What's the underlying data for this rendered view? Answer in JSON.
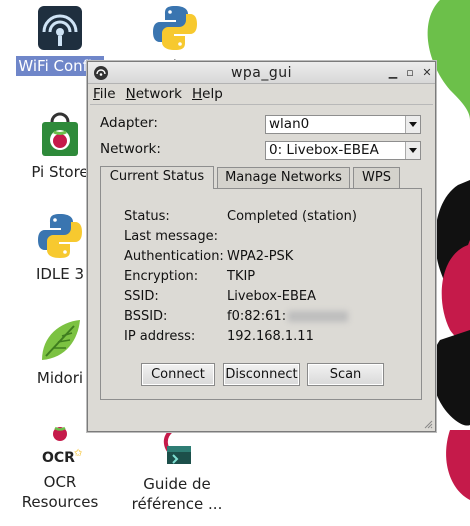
{
  "desktop": {
    "icons": [
      {
        "label": "WiFi Config",
        "icon": "wifi-icon",
        "selected": true
      },
      {
        "label": "Python",
        "icon": "python-icon"
      },
      {
        "label": "Pi Store",
        "icon": "store-icon"
      },
      {
        "label": "IDLE 3",
        "icon": "python-icon"
      },
      {
        "label": "Midori",
        "icon": "midori-icon"
      },
      {
        "label": "OCR Resources",
        "icon": "ocr-icon"
      },
      {
        "label": "Guide de référence ...",
        "icon": "debian-reference-icon"
      }
    ]
  },
  "window": {
    "title": "wpa_gui",
    "menu": [
      "File",
      "Network",
      "Help"
    ],
    "adapter": {
      "label": "Adapter:",
      "value": "wlan0"
    },
    "network": {
      "label": "Network:",
      "value": "0: Livebox-EBEA"
    },
    "tabs": [
      {
        "label": "Current Status",
        "active": true
      },
      {
        "label": "Manage Networks",
        "active": false
      },
      {
        "label": "WPS",
        "active": false
      }
    ],
    "status": {
      "status_label": "Status:",
      "status_value": "Completed (station)",
      "last_message_label": "Last message:",
      "last_message_value": "",
      "auth_label": "Authentication:",
      "auth_value": "WPA2-PSK",
      "enc_label": "Encryption:",
      "enc_value": "TKIP",
      "ssid_label": "SSID:",
      "ssid_value": "Livebox-EBEA",
      "bssid_label": "BSSID:",
      "bssid_value": "f0:82:61:",
      "ip_label": "IP address:",
      "ip_value": "192.168.1.11"
    },
    "buttons": {
      "connect": "Connect",
      "disconnect": "Disconnect",
      "scan": "Scan"
    }
  },
  "colors": {
    "selection": "#6f86c9",
    "raspberry": "#c51a4a",
    "window_bg": "#dcdad5"
  }
}
